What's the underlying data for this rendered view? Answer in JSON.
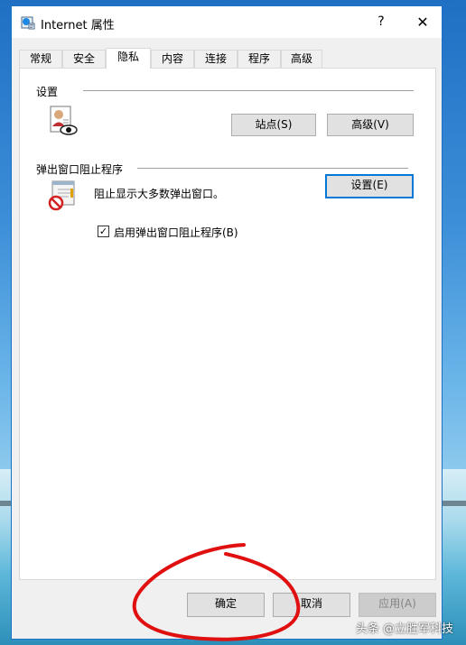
{
  "window": {
    "title": "Internet 属性",
    "help_symbol": "?",
    "close_symbol": "✕"
  },
  "tabs": [
    {
      "label": "常规"
    },
    {
      "label": "安全"
    },
    {
      "label": "隐私"
    },
    {
      "label": "内容"
    },
    {
      "label": "连接"
    },
    {
      "label": "程序"
    },
    {
      "label": "高级"
    }
  ],
  "settings_group": {
    "title": "设置",
    "sites_button": "站点(S)",
    "advanced_button": "高级(V)"
  },
  "popup_group": {
    "title": "弹出窗口阻止程序",
    "description": "阻止显示大多数弹出窗口。",
    "settings_button": "设置(E)",
    "checkbox_label": "启用弹出窗口阻止程序(B)",
    "checkbox_checked": true,
    "checkbox_mark": "✓"
  },
  "footer": {
    "ok_button": "确定",
    "cancel_button": "取消",
    "apply_button": "应用(A)"
  },
  "watermark": "头条 @立胜军科技",
  "colors": {
    "accent": "#0078d7",
    "annotation_circle": "#e01010"
  }
}
